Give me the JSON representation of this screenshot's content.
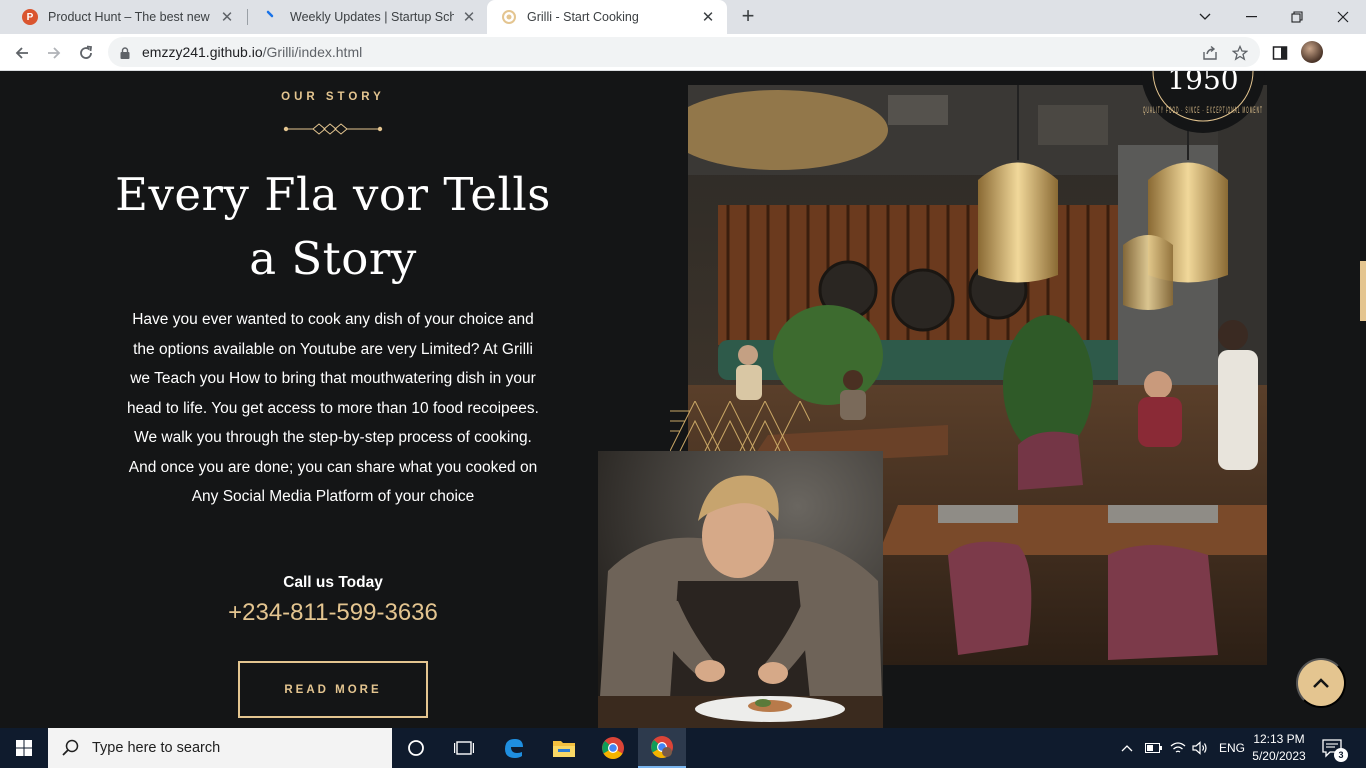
{
  "browser": {
    "tabs": [
      {
        "title": "Product Hunt – The best new pro",
        "favicon_color": "#da552f",
        "favicon_letter": "P",
        "active": false
      },
      {
        "title": "Weekly Updates | Startup School",
        "favicon_color": "#1a73e8",
        "favicon_letter": "",
        "active": false
      },
      {
        "title": "Grilli - Start Cooking",
        "favicon_color": "#e4c590",
        "favicon_letter": "",
        "active": true
      }
    ],
    "new_tab": "+",
    "url_host": "emzzy241.github.io",
    "url_path": "/Grilli/index.html"
  },
  "page": {
    "eyebrow": "OUR STORY",
    "heading": "Every Fla vor Tells a Story",
    "body": "Have you ever wanted to cook any dish of your choice and the options available on Youtube are very Limited? At Grilli we Teach you How to bring that mouthwatering dish in your head to life. You get access to more than 10 food recoipees. We walk you through the step-by-step process of cooking. And once you are done; you can share what you cooked on Any Social Media Platform of your choice",
    "call_label": "Call us Today",
    "phone": "+234-811-599-3636",
    "read_more": "READ MORE",
    "badge_year": "1950",
    "badge_ring_text": "QUALITY FOOD · SINCE · EXCEPTIONAL MOMENT",
    "accent_color": "#e4c590",
    "background_color": "#141516"
  },
  "taskbar": {
    "search_placeholder": "Type here to search",
    "language": "ENG",
    "time": "12:13 PM",
    "date": "5/20/2023",
    "notification_count": "3"
  }
}
